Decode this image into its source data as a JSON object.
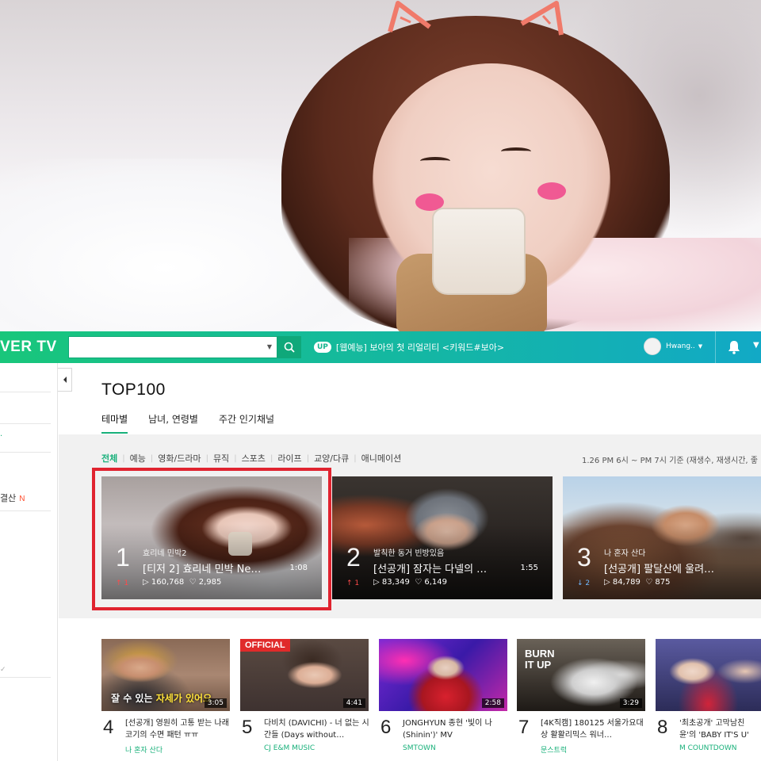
{
  "nav": {
    "logo": "VER TV",
    "search_placeholder": "",
    "promo_badge": "UP",
    "promo_text": "[웹예능] 보아의 첫 리얼리티 <키워드#보아>",
    "username": "Hwang.."
  },
  "sidebar": {
    "item_label": "결산",
    "item_badge": "N"
  },
  "main": {
    "title": "TOP100",
    "subtabs": [
      "테마별",
      "남녀, 연령별",
      "주간 인기채널"
    ],
    "categories": [
      "전체",
      "예능",
      "영화/드라마",
      "뮤직",
      "스포츠",
      "라이프",
      "교양/다큐",
      "애니메이션"
    ],
    "time_note": "1.26 PM 6시 ~ PM 7시 기준 (재생수, 재생시간, 좋"
  },
  "featured": [
    {
      "rank": "1",
      "program": "효리네 민박2",
      "title": "[티저 2] 효리네 민박 Ne…",
      "duration": "1:08",
      "views": "▷ 160,768",
      "likes": "♡ 2,985",
      "delta": "↑ 1"
    },
    {
      "rank": "2",
      "program": "발칙한 동거 빈방있음",
      "title": "[선공개] 잠자는 다넬의 …",
      "duration": "1:55",
      "views": "▷ 83,349",
      "likes": "♡ 6,149",
      "delta": "↑ 1"
    },
    {
      "rank": "3",
      "program": "나 혼자 산다",
      "title": "[선공개] 팔달산에 울려…",
      "duration": "",
      "views": "▷ 84,789",
      "likes": "♡ 875",
      "delta": "↓ 2"
    }
  ],
  "grid": [
    {
      "rank": "4",
      "title": "[선공개] 영원히 고통 받는 나래코기의 수면 패턴 ㅠㅠ",
      "channel": "나 혼자 산다",
      "duration": "3:05",
      "caption_a": "잘 수 있는 ",
      "caption_b": "자세가 있어요"
    },
    {
      "rank": "5",
      "title": "다비치 (DAVICHI) - 너 없는 시간들 (Days without…",
      "channel": "CJ E&M MUSIC",
      "duration": "4:41",
      "badge": "OFFICIAL"
    },
    {
      "rank": "6",
      "title": "JONGHYUN 종현 '빛이 나 (Shinin')' MV",
      "channel": "SMTOWN",
      "duration": "2:58"
    },
    {
      "rank": "7",
      "title": "[4K직캠] 180125 서울가요대상 활활리믹스 워너…",
      "channel": "문스트럭",
      "duration": "3:29",
      "overlay": "BURN IT UP"
    },
    {
      "rank": "8",
      "title": "'최초공개' 고막남친 윤'의 'BABY IT'S U'",
      "channel": "M COUNTDOWN",
      "duration": ""
    }
  ]
}
